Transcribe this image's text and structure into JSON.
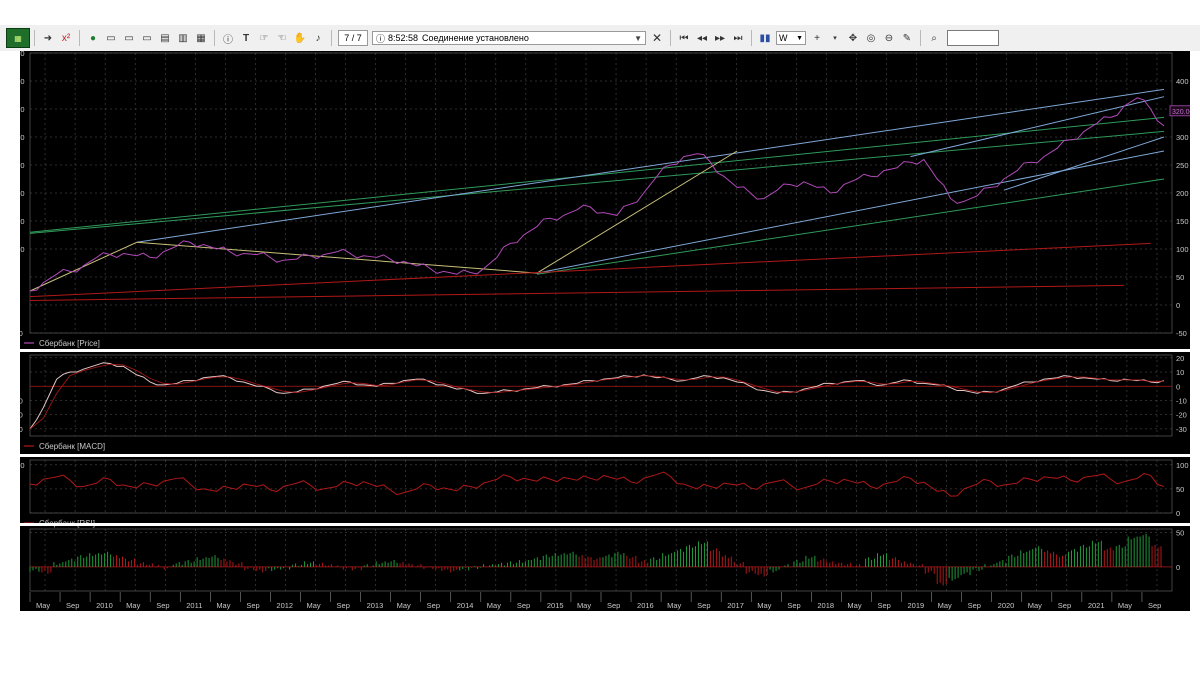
{
  "toolbar": {
    "counter": "7 / 7",
    "status_time": "8:52:58",
    "status_text": "Соединение установлено",
    "period": "W",
    "search_value": "",
    "icons": [
      "app-logo-icon",
      "arrow-right-icon",
      "x-red-icon",
      "new-chart-icon",
      "window-icon",
      "window2-icon",
      "window3-icon",
      "print-icon",
      "copy-icon",
      "save-icon",
      "info-icon",
      "text-icon",
      "hand-icon",
      "hand2-icon",
      "hand3-icon",
      "bell-icon",
      "first-icon",
      "prev-icon",
      "next-icon",
      "last-icon",
      "bars-icon",
      "crosshair-icon",
      "move-icon",
      "target-icon",
      "minus-circle-icon",
      "pencil-icon",
      "search-icon"
    ]
  },
  "chart_data": [
    {
      "type": "line",
      "panel": "price",
      "legend": "Сбербанк [Price]",
      "ylim": [
        -50,
        450
      ],
      "yticks": [
        450,
        400,
        350,
        300,
        250,
        200,
        150,
        100,
        50,
        0,
        -50
      ],
      "yticks_right": [
        400,
        350,
        300,
        250,
        200,
        150,
        100,
        50,
        0,
        -50
      ],
      "last_price_label": "320.00",
      "colors": {
        "price": "#b04ab8",
        "trend_green": "#2f9a5a",
        "trend_blue": "#7fa8d8",
        "trend_yellow": "#c8c07a",
        "trend_red": "#b01818"
      },
      "series": [
        {
          "values": [
            25,
            40,
            55,
            60,
            70,
            85,
            90,
            92,
            88,
            85,
            95,
            105,
            112,
            108,
            100,
            95,
            92,
            90,
            85,
            80,
            82,
            88,
            90,
            95,
            92,
            88,
            85,
            82,
            78,
            70,
            65,
            60,
            55,
            58,
            65,
            85,
            110,
            125,
            140,
            155,
            160,
            170,
            175,
            165,
            160,
            180,
            200,
            230,
            250,
            265,
            270,
            255,
            230,
            210,
            200,
            190,
            205,
            215,
            220,
            210,
            200,
            215,
            225,
            230,
            240,
            245,
            255,
            260,
            225,
            190,
            185,
            195,
            210,
            225,
            240,
            255,
            265,
            280,
            295,
            310,
            325,
            335,
            355,
            370,
            350,
            320
          ]
        }
      ],
      "trendlines": [
        {
          "color": "green",
          "from": [
            0,
            130
          ],
          "to": [
            85,
            335
          ]
        },
        {
          "color": "green",
          "from": [
            0,
            128
          ],
          "to": [
            85,
            310
          ]
        },
        {
          "color": "blue",
          "from": [
            8,
            112
          ],
          "to": [
            85,
            385
          ]
        },
        {
          "color": "blue",
          "from": [
            38,
            57
          ],
          "to": [
            85,
            275
          ]
        },
        {
          "color": "yellow",
          "from": [
            0,
            25
          ],
          "to": [
            8,
            112
          ]
        },
        {
          "color": "yellow",
          "from": [
            8,
            112
          ],
          "to": [
            38,
            57
          ]
        },
        {
          "color": "yellow",
          "from": [
            38,
            57
          ],
          "to": [
            53,
            275
          ]
        },
        {
          "color": "green",
          "from": [
            38,
            55
          ],
          "to": [
            85,
            225
          ]
        },
        {
          "color": "blue",
          "from": [
            66,
            265
          ],
          "to": [
            85,
            372
          ]
        },
        {
          "color": "blue",
          "from": [
            73,
            205
          ],
          "to": [
            85,
            300
          ]
        },
        {
          "color": "red",
          "from": [
            0,
            15
          ],
          "to": [
            84,
            110
          ]
        },
        {
          "color": "red",
          "from": [
            0,
            8
          ],
          "to": [
            82,
            35
          ]
        }
      ]
    },
    {
      "type": "line",
      "panel": "macd",
      "legend": "Сбербанк [MACD]",
      "ylim": [
        -35,
        22
      ],
      "yticks": [
        20,
        10,
        0,
        -10,
        -20,
        -30
      ],
      "series": [
        {
          "values": [
            -30,
            -15,
            5,
            10,
            12,
            15,
            16,
            14,
            8,
            3,
            1,
            2,
            4,
            6,
            7,
            6,
            3,
            0,
            -2,
            -5,
            -4,
            -2,
            0,
            2,
            3,
            1,
            0,
            2,
            4,
            5,
            3,
            1,
            -2,
            -3,
            -5,
            -4,
            -3,
            -2,
            -1,
            0,
            1,
            2,
            4,
            5,
            6,
            7,
            8,
            6,
            5,
            4,
            6,
            7,
            6,
            3,
            0,
            -3,
            -5,
            -4,
            -2,
            0,
            2,
            3,
            4,
            2,
            1,
            3,
            4,
            2,
            1,
            -1,
            -3,
            -5,
            -4,
            -2,
            1,
            3,
            5,
            6,
            7,
            6,
            5,
            4,
            5,
            4,
            3,
            4
          ]
        }
      ]
    },
    {
      "type": "line",
      "panel": "rsi",
      "legend": "Сбербанк [RSI]",
      "ylim": [
        0,
        110
      ],
      "yticks": [
        100,
        50,
        0
      ],
      "series": [
        {
          "values": [
            60,
            70,
            75,
            68,
            55,
            62,
            70,
            58,
            52,
            60,
            66,
            72,
            60,
            50,
            45,
            52,
            60,
            55,
            48,
            55,
            62,
            58,
            50,
            55,
            62,
            65,
            55,
            48,
            42,
            50,
            58,
            52,
            46,
            55,
            62,
            70,
            75,
            72,
            66,
            70,
            74,
            68,
            72,
            78,
            70,
            65,
            72,
            80,
            76,
            60,
            50,
            55,
            62,
            58,
            52,
            60,
            66,
            58,
            52,
            60,
            66,
            70,
            62,
            55,
            60,
            66,
            72,
            64,
            45,
            35,
            50,
            60,
            66,
            58,
            62,
            70,
            75,
            72,
            68,
            74,
            78,
            70,
            65,
            72,
            78,
            55
          ]
        }
      ]
    },
    {
      "type": "bar",
      "panel": "ao",
      "legend": "Сбербанк [AO]",
      "ylim": [
        -35,
        55
      ],
      "yticks": [
        50,
        0
      ],
      "colors": {
        "up": "#1f9b3a",
        "down": "#b01818"
      },
      "values": [
        -5,
        -8,
        5,
        10,
        15,
        18,
        20,
        15,
        10,
        5,
        3,
        -2,
        5,
        8,
        12,
        15,
        10,
        5,
        -3,
        -6,
        -4,
        -2,
        3,
        6,
        4,
        2,
        -2,
        -3,
        2,
        6,
        8,
        5,
        2,
        -1,
        -4,
        -6,
        -3,
        -1,
        2,
        4,
        6,
        8,
        12,
        16,
        18,
        20,
        15,
        12,
        16,
        20,
        14,
        8,
        12,
        18,
        24,
        30,
        35,
        25,
        15,
        5,
        -8,
        -12,
        -6,
        2,
        8,
        14,
        10,
        6,
        4,
        2,
        12,
        18,
        12,
        6,
        2,
        -8,
        -25,
        -18,
        -10,
        -4,
        2,
        8,
        16,
        22,
        28,
        22,
        16,
        24,
        30,
        36,
        26,
        30,
        42,
        46,
        30
      ]
    }
  ],
  "time_axis": [
    "May",
    "Sep",
    "2010",
    "May",
    "Sep",
    "2011",
    "May",
    "Sep",
    "2012",
    "May",
    "Sep",
    "2013",
    "May",
    "Sep",
    "2014",
    "May",
    "Sep",
    "2015",
    "May",
    "Sep",
    "2016",
    "May",
    "Sep",
    "2017",
    "May",
    "Sep",
    "2018",
    "May",
    "Sep",
    "2019",
    "May",
    "Sep",
    "2020",
    "May",
    "Sep",
    "2021",
    "May",
    "Sep"
  ]
}
